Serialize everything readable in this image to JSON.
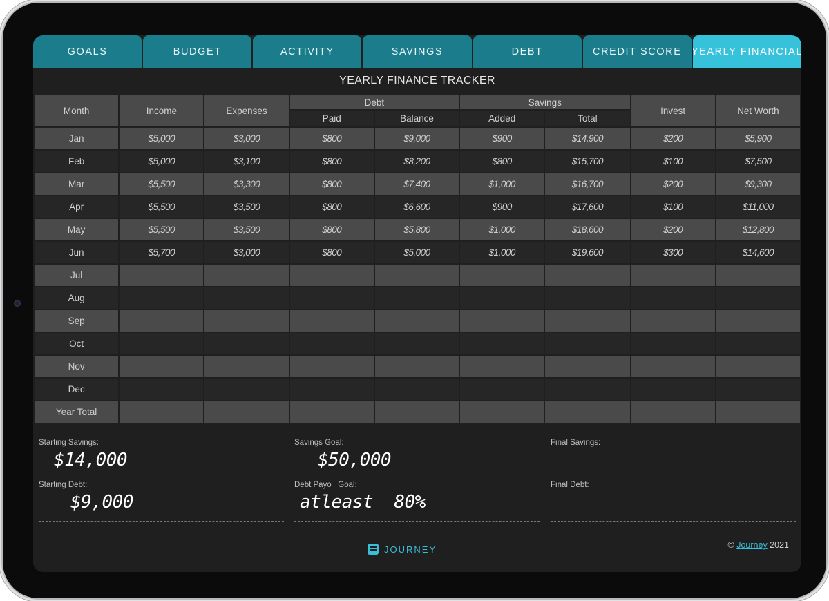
{
  "tabs": [
    {
      "label": "GOALS",
      "active": false
    },
    {
      "label": "BUDGET",
      "active": false
    },
    {
      "label": "ACTIVITY",
      "active": false
    },
    {
      "label": "SAVINGS",
      "active": false
    },
    {
      "label": "DEBT",
      "active": false
    },
    {
      "label": "CREDIT SCORE",
      "active": false
    },
    {
      "label": "YEARLY FINANCIAL",
      "active": true
    }
  ],
  "page_title": "YEARLY FINANCE TRACKER",
  "table": {
    "headers": {
      "month": "Month",
      "income": "Income",
      "expenses": "Expenses",
      "debt_group": "Debt",
      "debt_paid": "Paid",
      "debt_balance": "Balance",
      "savings_group": "Savings",
      "savings_added": "Added",
      "savings_total": "Total",
      "invest": "Invest",
      "net_worth": "Net Worth"
    },
    "rows": [
      {
        "month": "Jan",
        "ink": "purple",
        "income": "$5,000",
        "expenses": "$3,000",
        "paid": "$800",
        "balance": "$9,000",
        "added": "$900",
        "total": "$14,900",
        "invest": "$200",
        "net_worth": "$5,900"
      },
      {
        "month": "Feb",
        "ink": "green",
        "income": "$5,000",
        "expenses": "$3,100",
        "paid": "$800",
        "balance": "$8,200",
        "added": "$800",
        "total": "$15,700",
        "invest": "$100",
        "net_worth": "$7,500"
      },
      {
        "month": "Mar",
        "ink": "purple",
        "income": "$5,500",
        "expenses": "$3,300",
        "paid": "$800",
        "balance": "$7,400",
        "added": "$1,000",
        "total": "$16,700",
        "invest": "$200",
        "net_worth": "$9,300"
      },
      {
        "month": "Apr",
        "ink": "green",
        "income": "$5,500",
        "expenses": "$3,500",
        "paid": "$800",
        "balance": "$6,600",
        "added": "$900",
        "total": "$17,600",
        "invest": "$100",
        "net_worth": "$11,000"
      },
      {
        "month": "May",
        "ink": "purple",
        "income": "$5,500",
        "expenses": "$3,500",
        "paid": "$800",
        "balance": "$5,800",
        "added": "$1,000",
        "total": "$18,600",
        "invest": "$200",
        "net_worth": "$12,800"
      },
      {
        "month": "Jun",
        "ink": "green",
        "income": "$5,700",
        "expenses": "$3,000",
        "paid": "$800",
        "balance": "$5,000",
        "added": "$1,000",
        "total": "$19,600",
        "invest": "$300",
        "net_worth": "$14,600"
      },
      {
        "month": "Jul",
        "ink": "none",
        "income": "",
        "expenses": "",
        "paid": "",
        "balance": "",
        "added": "",
        "total": "",
        "invest": "",
        "net_worth": ""
      },
      {
        "month": "Aug",
        "ink": "none",
        "income": "",
        "expenses": "",
        "paid": "",
        "balance": "",
        "added": "",
        "total": "",
        "invest": "",
        "net_worth": ""
      },
      {
        "month": "Sep",
        "ink": "none",
        "income": "",
        "expenses": "",
        "paid": "",
        "balance": "",
        "added": "",
        "total": "",
        "invest": "",
        "net_worth": ""
      },
      {
        "month": "Oct",
        "ink": "none",
        "income": "",
        "expenses": "",
        "paid": "",
        "balance": "",
        "added": "",
        "total": "",
        "invest": "",
        "net_worth": ""
      },
      {
        "month": "Nov",
        "ink": "none",
        "income": "",
        "expenses": "",
        "paid": "",
        "balance": "",
        "added": "",
        "total": "",
        "invest": "",
        "net_worth": ""
      },
      {
        "month": "Dec",
        "ink": "none",
        "income": "",
        "expenses": "",
        "paid": "",
        "balance": "",
        "added": "",
        "total": "",
        "invest": "",
        "net_worth": ""
      },
      {
        "month": "Year Total",
        "ink": "none",
        "income": "",
        "expenses": "",
        "paid": "",
        "balance": "",
        "added": "",
        "total": "",
        "invest": "",
        "net_worth": ""
      }
    ]
  },
  "fields": {
    "starting_savings": {
      "label": "Starting Savings:",
      "value": "$14,000"
    },
    "savings_goal": {
      "label": "Savings Goal:",
      "value": "$50,000"
    },
    "final_savings": {
      "label": "Final Savings:",
      "value": ""
    },
    "starting_debt": {
      "label": "Starting Debt:",
      "value": "$9,000"
    },
    "debt_payoff_goal": {
      "label": "Debt Payo   Goal:",
      "value": "atleast  80%"
    },
    "final_debt": {
      "label": "Final Debt:",
      "value": ""
    }
  },
  "brand": {
    "name": "JOURNEY",
    "icon": "journal-icon"
  },
  "footer": {
    "copyright_symbol": "©",
    "link": "Journey",
    "year": "2021"
  },
  "colors": {
    "tab": "#1b7d8c",
    "tab_active": "#37c2dc",
    "ink_purple": "#c9c6ff",
    "ink_green": "#2ee63a",
    "accent": "#36c0da"
  }
}
